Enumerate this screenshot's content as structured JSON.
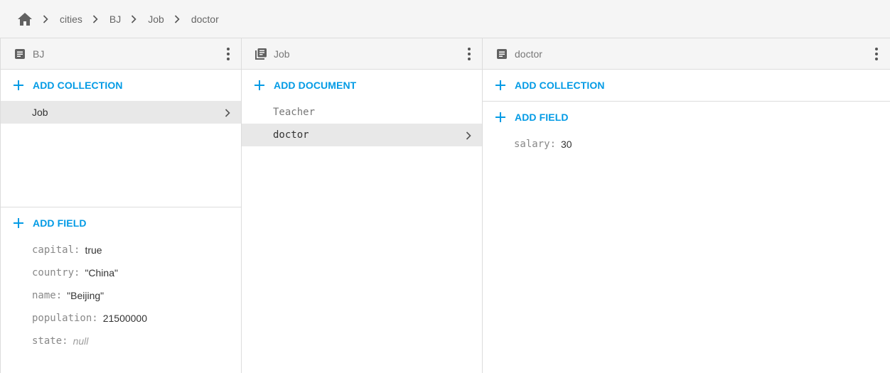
{
  "breadcrumb": {
    "items": [
      "cities",
      "BJ",
      "Job",
      "doctor"
    ]
  },
  "panel1": {
    "title": "BJ",
    "add_collection_label": "ADD COLLECTION",
    "collections": [
      "Job"
    ],
    "add_field_label": "ADD FIELD",
    "fields": [
      {
        "key": "capital:",
        "value": "true"
      },
      {
        "key": "country:",
        "value": "\"China\""
      },
      {
        "key": "name:",
        "value": "\"Beijing\""
      },
      {
        "key": "population:",
        "value": "21500000"
      },
      {
        "key": "state:",
        "value": "null"
      }
    ]
  },
  "panel2": {
    "title": "Job",
    "add_document_label": "ADD DOCUMENT",
    "documents": [
      "Teacher",
      "doctor"
    ]
  },
  "panel3": {
    "title": "doctor",
    "add_collection_label": "ADD COLLECTION",
    "add_field_label": "ADD FIELD",
    "fields": [
      {
        "key": "salary:",
        "value": "30"
      }
    ]
  },
  "colors": {
    "accent": "#039be5",
    "selected_bg": "#e8e8e8",
    "header_bg": "#f5f5f5"
  },
  "icons": {
    "home": "home-icon",
    "chevron": "chevron-right-icon",
    "document": "document-icon",
    "collection": "collection-icon",
    "more": "more-vert-icon",
    "add": "plus-icon"
  }
}
